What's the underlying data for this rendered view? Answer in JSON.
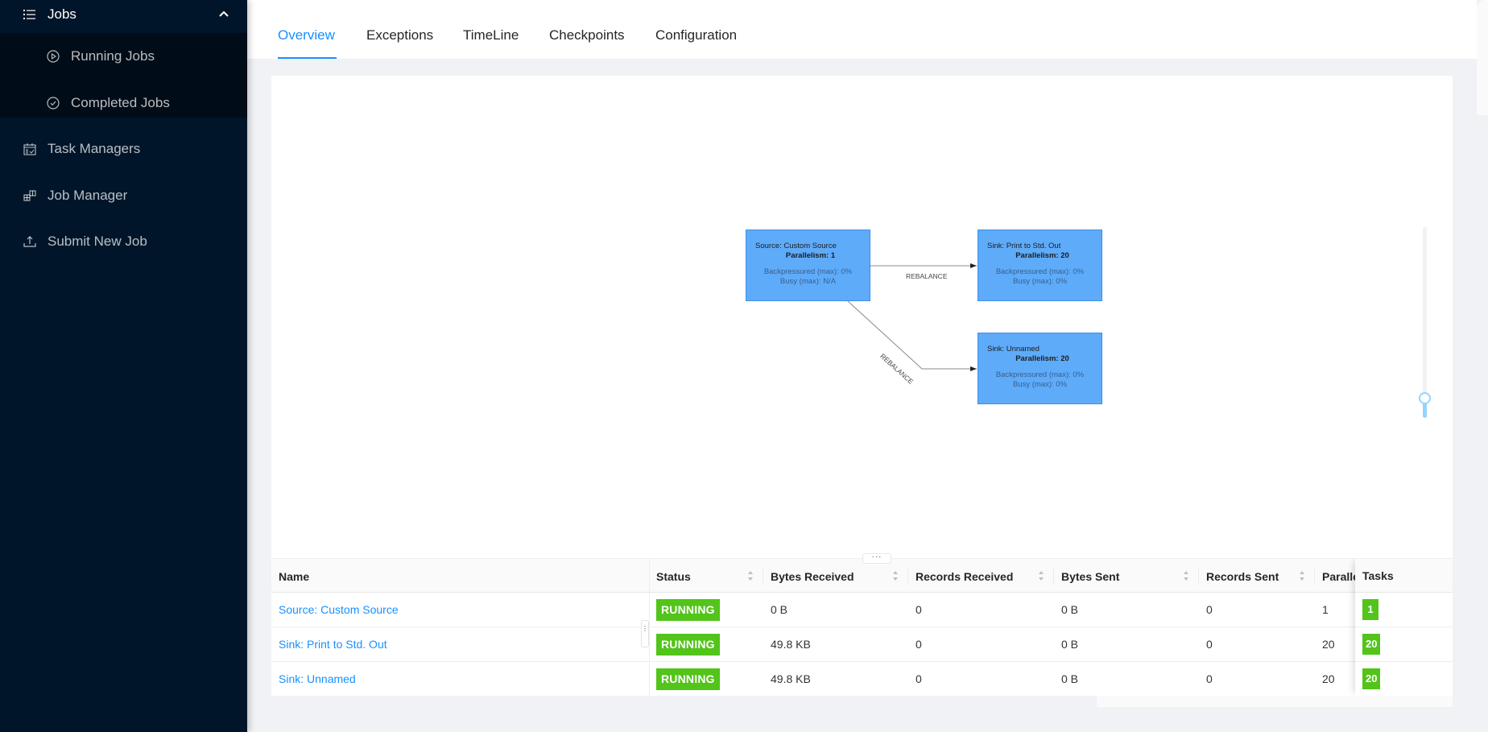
{
  "sidebar": {
    "jobs_label": "Jobs",
    "items": [
      {
        "label": "Running Jobs",
        "icon": "play-circle-icon"
      },
      {
        "label": "Completed Jobs",
        "icon": "check-circle-icon"
      },
      {
        "label": "Task Managers",
        "icon": "schedule-icon"
      },
      {
        "label": "Job Manager",
        "icon": "build-icon"
      },
      {
        "label": "Submit New Job",
        "icon": "upload-icon"
      }
    ]
  },
  "tabs": [
    {
      "label": "Overview",
      "active": true
    },
    {
      "label": "Exceptions",
      "active": false
    },
    {
      "label": "TimeLine",
      "active": false
    },
    {
      "label": "Checkpoints",
      "active": false
    },
    {
      "label": "Configuration",
      "active": false
    }
  ],
  "graph": {
    "nodes": [
      {
        "name": "Source: Custom Source",
        "parallelism": "Parallelism: 1",
        "backpressured": "Backpressured (max): 0%",
        "busy": "Busy (max): N/A"
      },
      {
        "name": "Sink: Print to Std. Out",
        "parallelism": "Parallelism: 20",
        "backpressured": "Backpressured (max): 0%",
        "busy": "Busy (max): 0%"
      },
      {
        "name": "Sink: Unnamed",
        "parallelism": "Parallelism: 20",
        "backpressured": "Backpressured (max): 0%",
        "busy": "Busy (max): 0%"
      }
    ],
    "edges": [
      {
        "from": 0,
        "to": 1,
        "label": "REBALANCE"
      },
      {
        "from": 0,
        "to": 2,
        "label": "REBALANCE"
      }
    ],
    "zoom_level_fraction": 0.1,
    "colors": {
      "node_fill": "#5eabf9",
      "node_border": "#3d8ee8"
    }
  },
  "table": {
    "columns": [
      "Name",
      "Status",
      "Bytes Received",
      "Records Received",
      "Bytes Sent",
      "Records Sent",
      "Paralle",
      "Tasks"
    ],
    "rows": [
      {
        "name": "Source: Custom Source",
        "status": "RUNNING",
        "bytes_received": "0 B",
        "records_received": "0",
        "bytes_sent": "0 B",
        "records_sent": "0",
        "parallelism": "1",
        "tasks": "1"
      },
      {
        "name": "Sink: Print to Std. Out",
        "status": "RUNNING",
        "bytes_received": "49.8 KB",
        "records_received": "0",
        "bytes_sent": "0 B",
        "records_sent": "0",
        "parallelism": "20",
        "tasks": "20"
      },
      {
        "name": "Sink: Unnamed",
        "status": "RUNNING",
        "bytes_received": "49.8 KB",
        "records_received": "0",
        "bytes_sent": "0 B",
        "records_sent": "0",
        "parallelism": "20",
        "tasks": "20"
      }
    ],
    "status_color": "#52c41a",
    "resize_handle": "···"
  }
}
